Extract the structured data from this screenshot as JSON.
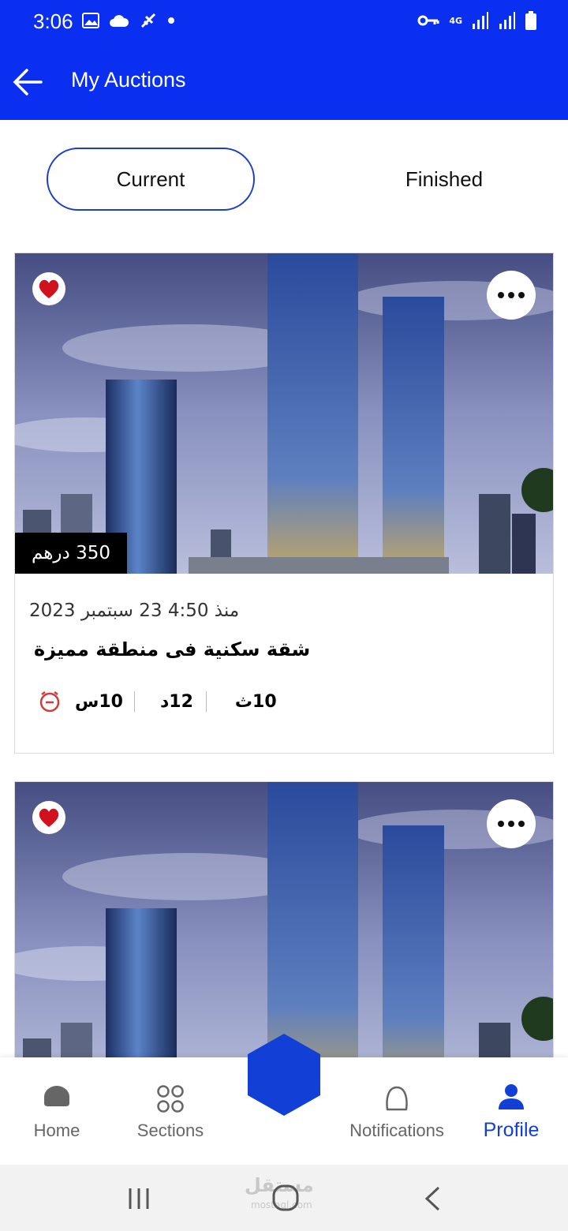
{
  "status_bar": {
    "time": "3:06",
    "network": "4G",
    "icons": [
      "image-icon",
      "cloud-icon",
      "satellite-icon",
      "dot-icon",
      "key-icon",
      "signal-icon",
      "signal-icon",
      "battery-icon"
    ]
  },
  "header": {
    "title": "My Auctions",
    "back_icon": "arrow-left-icon"
  },
  "tabs": [
    {
      "label": "Current",
      "active": true
    },
    {
      "label": "Finished",
      "active": false
    }
  ],
  "auctions": [
    {
      "price": "350 درهم",
      "date": "منذ 4:50   23 سبتمبر 2023",
      "title": "شقة سكنية فى منطقة مميزة",
      "countdown": {
        "seconds": "10ث",
        "minutes": "12د",
        "hours": "10س"
      },
      "favorite": true
    },
    {
      "favorite": true
    }
  ],
  "bottom_nav": [
    {
      "label": "Home",
      "icon": "home-icon",
      "active": false
    },
    {
      "label": "Sections",
      "icon": "grid-icon",
      "active": false
    },
    {
      "label": "Notifications",
      "icon": "bell-icon",
      "active": false
    },
    {
      "label": "Profile",
      "icon": "person-icon",
      "active": true
    }
  ],
  "system_nav": {
    "watermark": "مستقل",
    "watermark_sub": "mostaql.com"
  },
  "colors": {
    "primary": "#0a2ff0",
    "accent": "#1240d6",
    "favorite": "#d0121f",
    "timer": "#d43a3a"
  }
}
